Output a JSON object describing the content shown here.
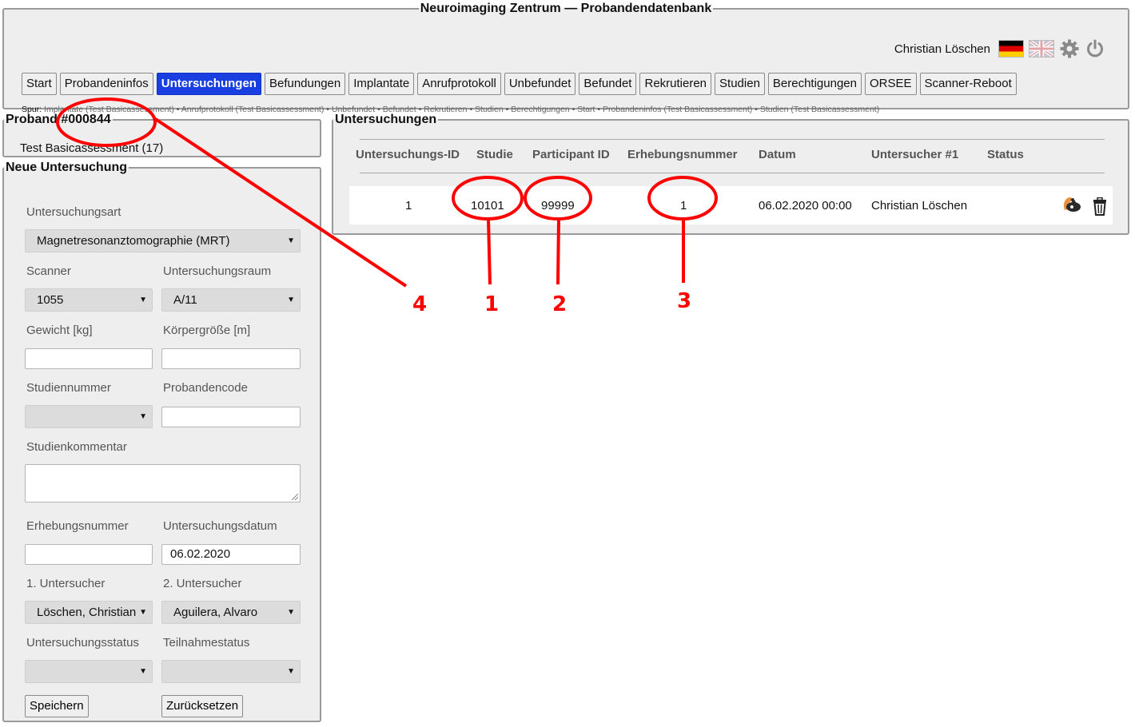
{
  "header": {
    "title": "Neuroimaging Zentrum — Probandendatenbank",
    "user_name": "Christian Löschen",
    "icons": [
      "flag-de-icon",
      "flag-uk-icon",
      "gear-icon",
      "power-icon"
    ]
  },
  "nav": {
    "items": [
      "Start",
      "Probandeninfos",
      "Untersuchungen",
      "Befundungen",
      "Implantate",
      "Anrufprotokoll",
      "Unbefundet",
      "Befundet",
      "Rekrutieren",
      "Studien",
      "Berechtigungen",
      "ORSEE",
      "Scanner-Reboot"
    ],
    "active": "Untersuchungen"
  },
  "breadcrumb": {
    "label": "Spur:",
    "items": [
      "Implantate (Test Basicassessment)",
      "Anrufprotokoll (Test Basicassessment)",
      "Unbefundet",
      "Befundet",
      "Rekrutieren",
      "Studien",
      "Berechtigungen",
      "Start",
      "Probandeninfos (Test Basicassessment)",
      "Studien (Test Basicassessment)"
    ],
    "separator": " • "
  },
  "proband": {
    "title": "Proband #000844",
    "info": "Test Basicassessment (17)"
  },
  "form": {
    "title": "Neue Untersuchung",
    "untersuchungsart_label": "Untersuchungsart",
    "untersuchungsart_value": "Magnetresonanztomographie (MRT)",
    "scanner_label": "Scanner",
    "scanner_value": "1055",
    "raum_label": "Untersuchungsraum",
    "raum_value": "A/11",
    "gewicht_label": "Gewicht [kg]",
    "gewicht_value": "",
    "groesse_label": "Körpergröße [m]",
    "groesse_value": "",
    "studiennummer_label": "Studiennummer",
    "studiennummer_value": "",
    "probandencode_label": "Probandencode",
    "probandencode_value": "",
    "studienkommentar_label": "Studienkommentar",
    "erhebungsnummer_label": "Erhebungsnummer",
    "erhebungsnummer_value": "",
    "datum_label": "Untersuchungsdatum",
    "datum_value": "06.02.2020",
    "u1_label": "1. Untersucher",
    "u1_value": "Löschen, Christian",
    "u2_label": "2. Untersucher",
    "u2_value": "Aguilera, Alvaro",
    "ustatus_label": "Untersuchungsstatus",
    "ustatus_value": "",
    "tstatus_label": "Teilnahmestatus",
    "tstatus_value": "",
    "save_label": "Speichern",
    "reset_label": "Zurücksetzen",
    "dropdown_arrow": "▼"
  },
  "table": {
    "title": "Untersuchungen",
    "columns": [
      "Untersuchungs-ID",
      "Studie",
      "Participant ID",
      "Erhebungsnummer",
      "Datum",
      "Untersucher #1",
      "Status"
    ],
    "rows": [
      {
        "id": "1",
        "studie": "10101",
        "participant": "99999",
        "erhebung": "1",
        "datum": "06.02.2020 00:00",
        "untersucher": "Christian Löschen",
        "status": ""
      }
    ],
    "row_icons": [
      "scan-edit-icon",
      "trash-icon"
    ]
  },
  "annotations": {
    "color": "#ff0000",
    "labels": [
      "1",
      "2",
      "3",
      "4"
    ]
  }
}
